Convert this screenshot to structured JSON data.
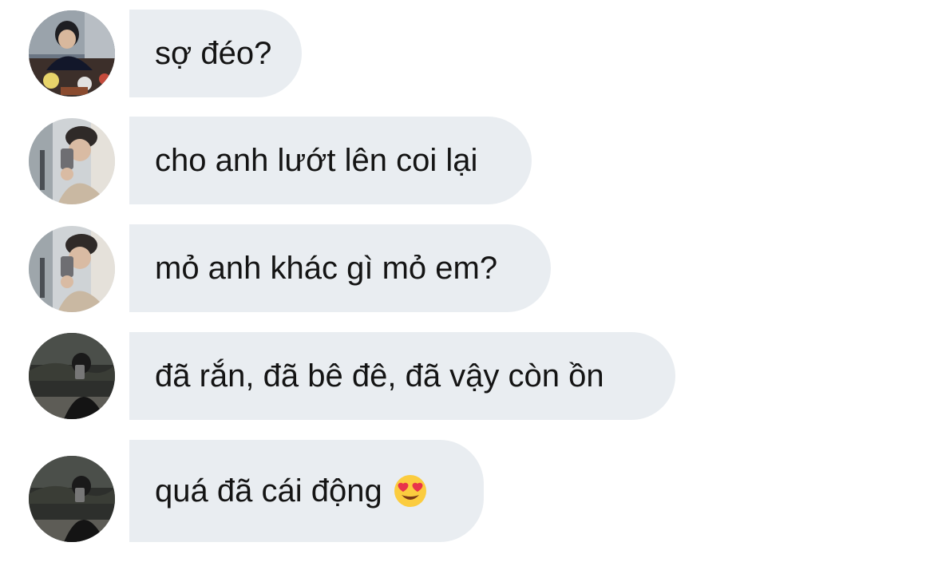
{
  "messages": [
    {
      "text": "sợ đéo?",
      "avatar": "avatar-eating"
    },
    {
      "text": "cho anh lướt lên coi lại",
      "avatar": "avatar-mirror-selfie"
    },
    {
      "text": "mỏ anh khác gì mỏ em?",
      "avatar": "avatar-mirror-selfie"
    },
    {
      "text": "đã rắn, đã bê đê, đã vậy còn ồn",
      "avatar": "avatar-dark-selfie"
    },
    {
      "text": "quá đã cái động",
      "avatar": "avatar-dark-selfie",
      "emoji": "heart-eyes-emoji"
    }
  ],
  "colors": {
    "bubble": "#e9edf1",
    "text": "#141414",
    "background": "#ffffff"
  }
}
